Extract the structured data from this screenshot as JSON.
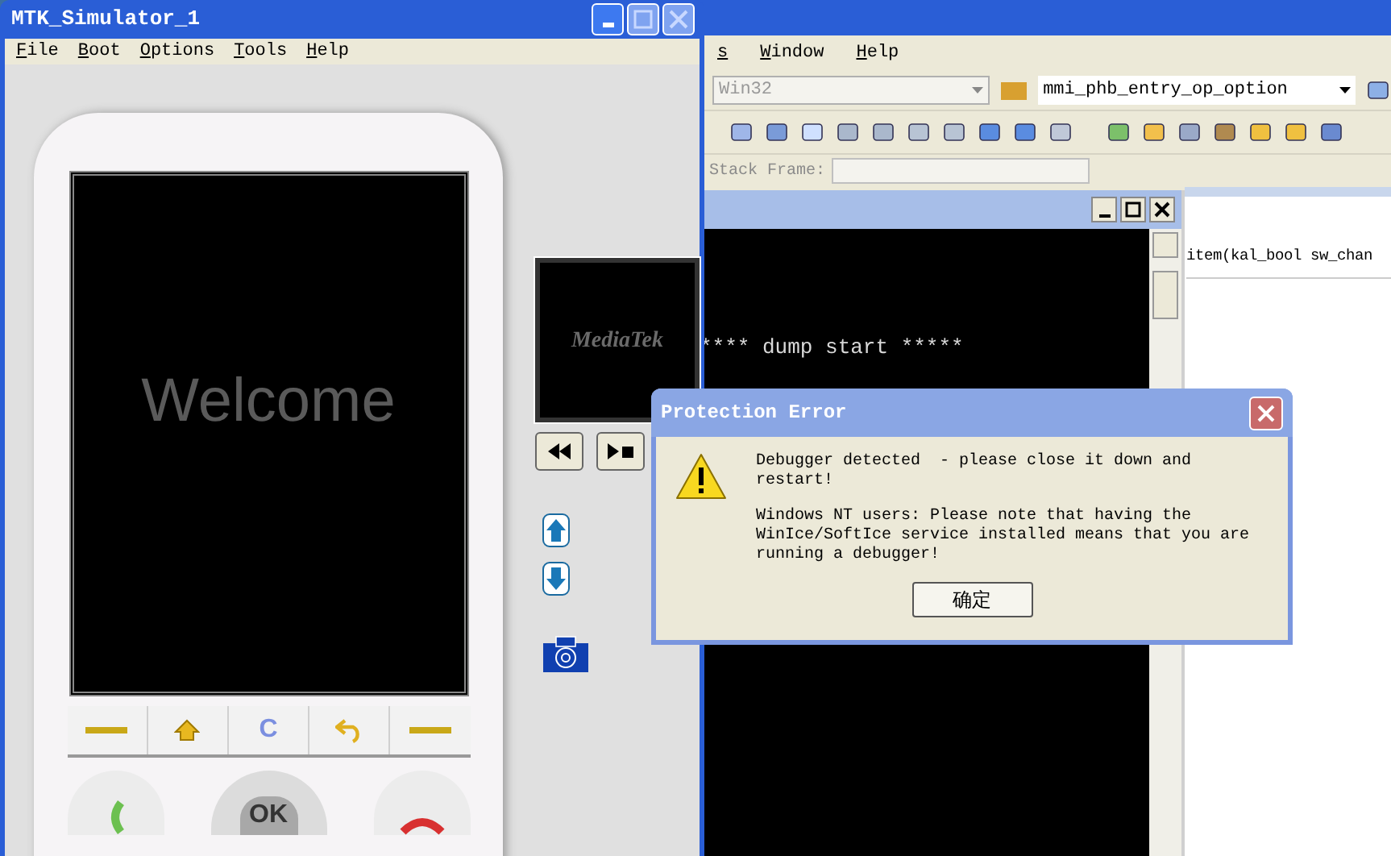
{
  "ide": {
    "menu": [
      "s",
      "Window",
      "Help"
    ],
    "platform_combo": "Win32",
    "function_combo": "mmi_phb_entry_op_option",
    "stack_frame_label": "Stack Frame:",
    "code_line": "item(kal_bool sw_chan"
  },
  "simulator": {
    "title": "MTK_Simulator_1",
    "menu": [
      "File",
      "Boot",
      "Options",
      "Tools",
      "Help"
    ],
    "screen_text": "Welcome",
    "media_logo": "MediaTek",
    "soft_keys": [
      {
        "kind": "dash"
      },
      {
        "kind": "home"
      },
      {
        "kind": "clear",
        "label": "C"
      },
      {
        "kind": "back"
      },
      {
        "kind": "dash"
      }
    ],
    "ok_key": "OK"
  },
  "console": {
    "lines": [
      "**** dump start *****"
    ]
  },
  "dialog": {
    "title": "Protection Error",
    "messages": [
      "Debugger detected  - please close it down and restart!",
      "Windows NT users: Please note that having the WinIce/SoftIce service installed means that you are running a debugger!"
    ],
    "button": "确定"
  }
}
